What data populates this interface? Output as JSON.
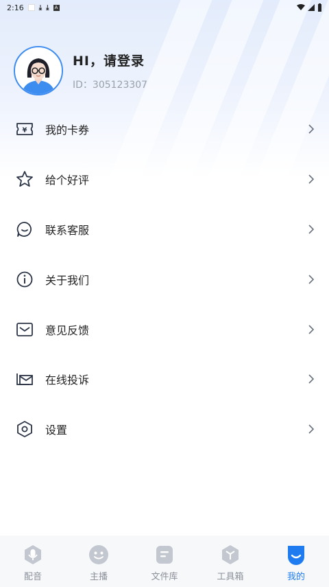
{
  "status_bar": {
    "time": "2:16"
  },
  "profile": {
    "title": "HI，请登录",
    "id_text": "ID：305123307"
  },
  "menu": {
    "items": [
      {
        "label": "我的卡券",
        "icon": "coupon-icon"
      },
      {
        "label": "给个好评",
        "icon": "star-icon"
      },
      {
        "label": "联系客服",
        "icon": "chat-icon"
      },
      {
        "label": "关于我们",
        "icon": "info-icon"
      },
      {
        "label": "意见反馈",
        "icon": "mail-icon"
      },
      {
        "label": "在线投诉",
        "icon": "envelope-stack-icon"
      },
      {
        "label": "设置",
        "icon": "hexagon-settings-icon"
      }
    ]
  },
  "tabbar": {
    "tabs": [
      {
        "label": "配音",
        "icon": "mic-icon"
      },
      {
        "label": "主播",
        "icon": "face-icon"
      },
      {
        "label": "文件库",
        "icon": "file-icon"
      },
      {
        "label": "工具箱",
        "icon": "toolbox-icon"
      },
      {
        "label": "我的",
        "icon": "profile-smile-icon",
        "active": true
      }
    ]
  },
  "colors": {
    "accent": "#1f7cf0",
    "avatar_border": "#3d8cf0",
    "icon": "#2b3446",
    "inactive_tab": "#c3c7cf"
  }
}
